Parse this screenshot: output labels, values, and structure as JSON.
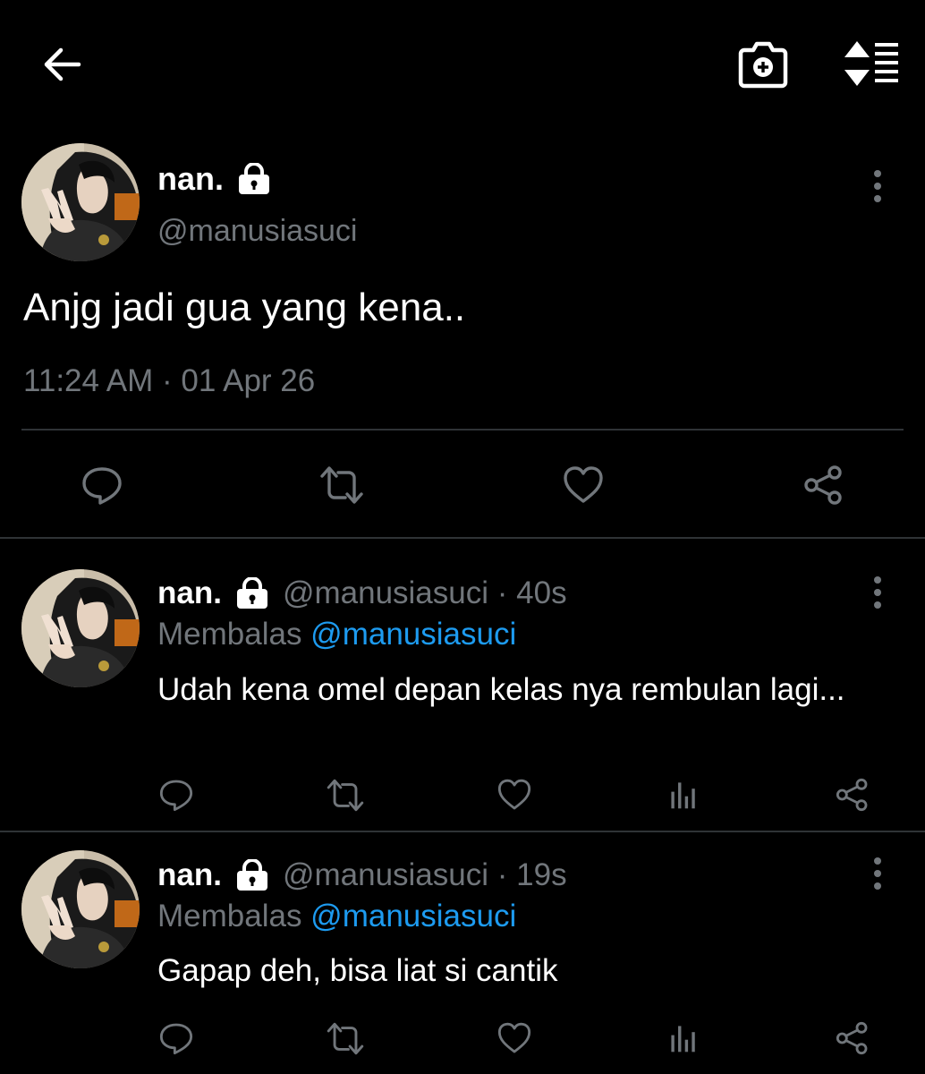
{
  "topbar": {
    "back_icon": "arrow-left-icon",
    "camera_icon": "camera-add-icon",
    "sort_icon": "sort-list-icon"
  },
  "main_tweet": {
    "name": "nan.",
    "lock_icon": "lock-icon",
    "handle": "@manusiasuci",
    "text": "Anjg jadi gua yang kena..",
    "timestamp": "11:24 AM · 01 Apr 26",
    "actions": [
      "reply-icon",
      "retweet-icon",
      "like-icon",
      "share-icon"
    ]
  },
  "replies": [
    {
      "name": "nan.",
      "handle": "@manusiasuci",
      "separator": " · ",
      "time": "40s",
      "replying_prefix": "Membalas ",
      "replying_to": "@manusiasuci",
      "text": "Udah kena omel depan kelas nya rembulan lagi..."
    },
    {
      "name": "nan.",
      "handle": "@manusiasuci",
      "separator": " · ",
      "time": "19s",
      "replying_prefix": "Membalas ",
      "replying_to": "@manusiasuci",
      "text": "Gapap deh, bisa liat si cantik"
    }
  ],
  "colors": {
    "background": "#000000",
    "muted": "#71767b",
    "accent": "#1d9bf0",
    "divider": "#2f3336"
  }
}
